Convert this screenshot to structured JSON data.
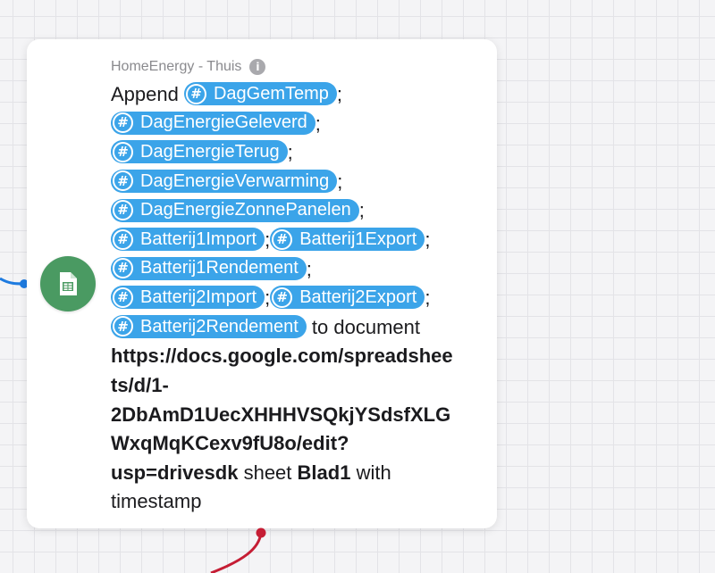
{
  "node": {
    "service_name": "HomeEnergy - Thuis",
    "info_glyph": "i",
    "hash_glyph": "#",
    "semicolon": ";",
    "text": {
      "append": "Append",
      "to_document": "to document",
      "url_lines": [
        "https://docs.google.com/spreadshee",
        "ts/d/1-",
        "2DbAmD1UecXHHHVSQkjYSdsfXLG",
        "WxqMqKCexv9fU8o/edit?",
        "usp=drivesdk"
      ],
      "sheet": "sheet",
      "sheet_name": "Blad1",
      "with": "with",
      "timestamp": "timestamp"
    },
    "ingredients": [
      "DagGemTemp",
      "DagEnergieGeleverd",
      "DagEnergieTerug",
      "DagEnergieVerwarming",
      "DagEnergieZonnePanelen",
      "Batterij1Import",
      "Batterij1Export",
      "Batterij1Rendement",
      "Batterij2Import",
      "Batterij2Export",
      "Batterij2Rendement"
    ],
    "icon": "google-sheets-icon"
  },
  "colors": {
    "pill": "#3ba4e9",
    "sheets_badge": "#4a9a62",
    "wire_in": "#1e7be0",
    "wire_out": "#c51d34"
  }
}
